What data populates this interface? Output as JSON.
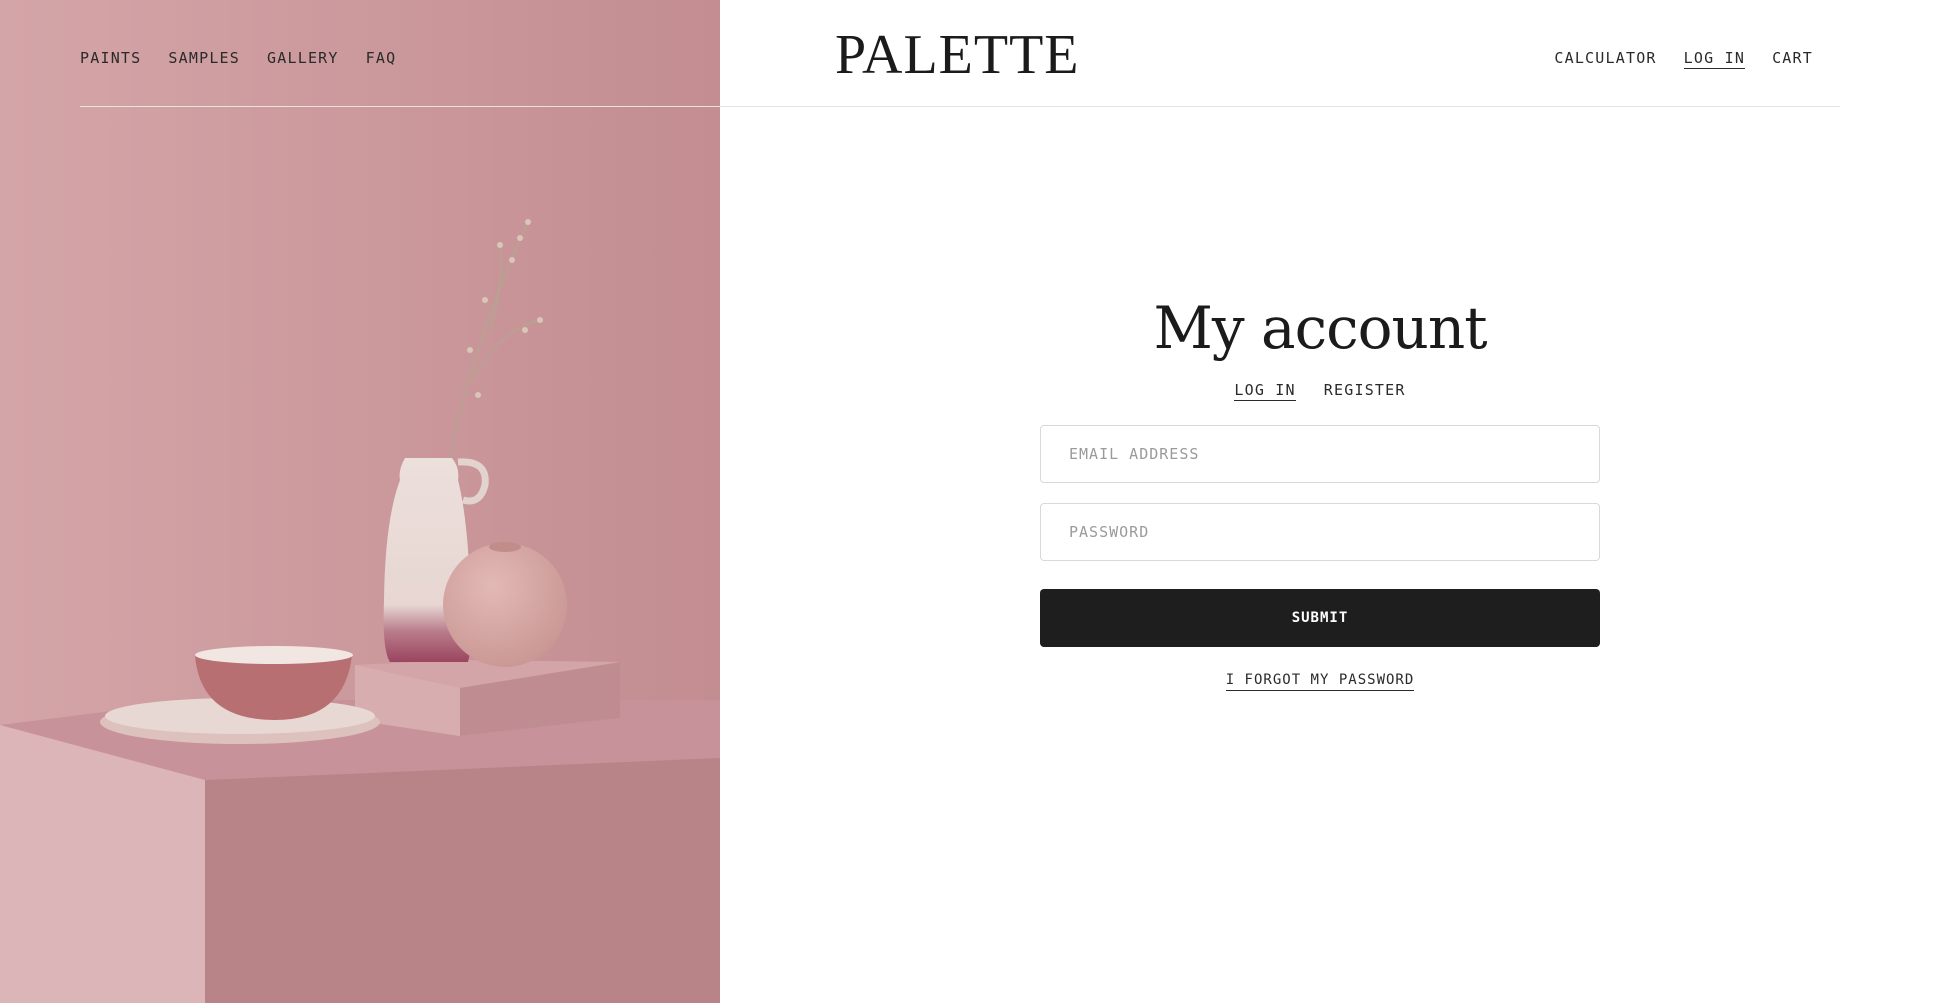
{
  "brand": {
    "logo": "PALETTE"
  },
  "nav_left": [
    {
      "label": "PAINTS"
    },
    {
      "label": "SAMPLES"
    },
    {
      "label": "GALLERY"
    },
    {
      "label": "FAQ"
    }
  ],
  "nav_right": [
    {
      "label": "CALCULATOR",
      "active": false
    },
    {
      "label": "LOG IN",
      "active": true
    },
    {
      "label": "CART",
      "active": false
    }
  ],
  "account": {
    "title": "My account",
    "tabs": [
      {
        "label": "LOG IN",
        "active": true
      },
      {
        "label": "REGISTER",
        "active": false
      }
    ],
    "email": {
      "placeholder": "EMAIL ADDRESS",
      "value": ""
    },
    "password": {
      "placeholder": "PASSWORD",
      "value": ""
    },
    "submit_label": "SUBMIT",
    "forgot_label": "I FORGOT MY PASSWORD"
  },
  "colors": {
    "hero_background": "#c99599",
    "button": "#1e1e1e",
    "text": "#1e1e1e"
  },
  "hero_image": {
    "subject": "pink still life with vases and bowls"
  }
}
